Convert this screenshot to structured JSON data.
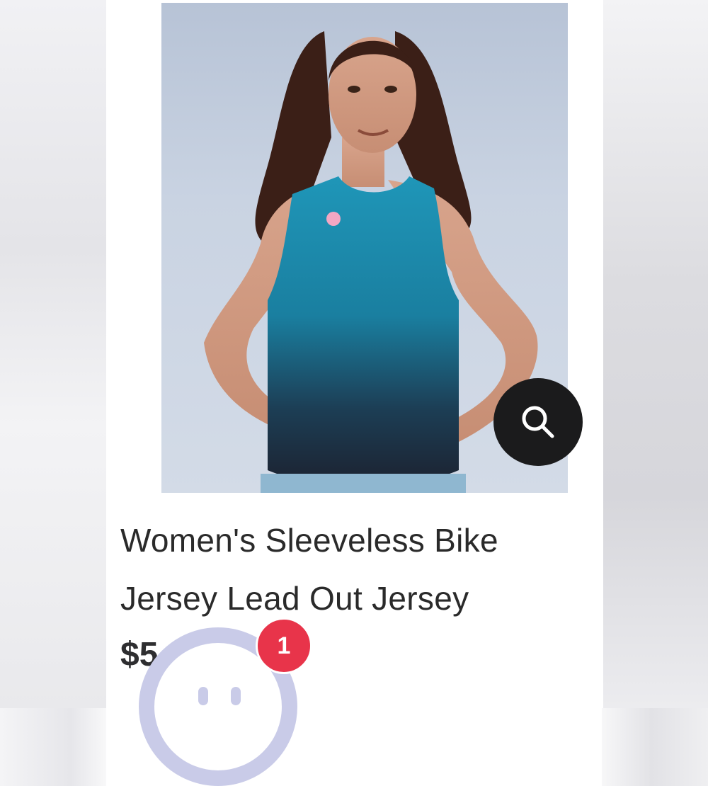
{
  "product": {
    "image_alt": "Woman wearing a teal to navy sleeveless bike jersey",
    "title_line1": "Women's Sleeveless Bike",
    "title_line2": "Jersey Lead Out Jersey",
    "price_visible": "$5"
  },
  "zoom_button": {
    "icon": "magnifier-icon"
  },
  "chat_widget": {
    "icon": "chat-bot-avatar-icon",
    "notification_count": "1"
  },
  "colors": {
    "jersey_top": "#1f8fb3",
    "jersey_bottom": "#1c2230",
    "badge": "#e8344a",
    "avatar_ring": "#c9cbe8",
    "zoom_button": "#1b1b1c"
  }
}
